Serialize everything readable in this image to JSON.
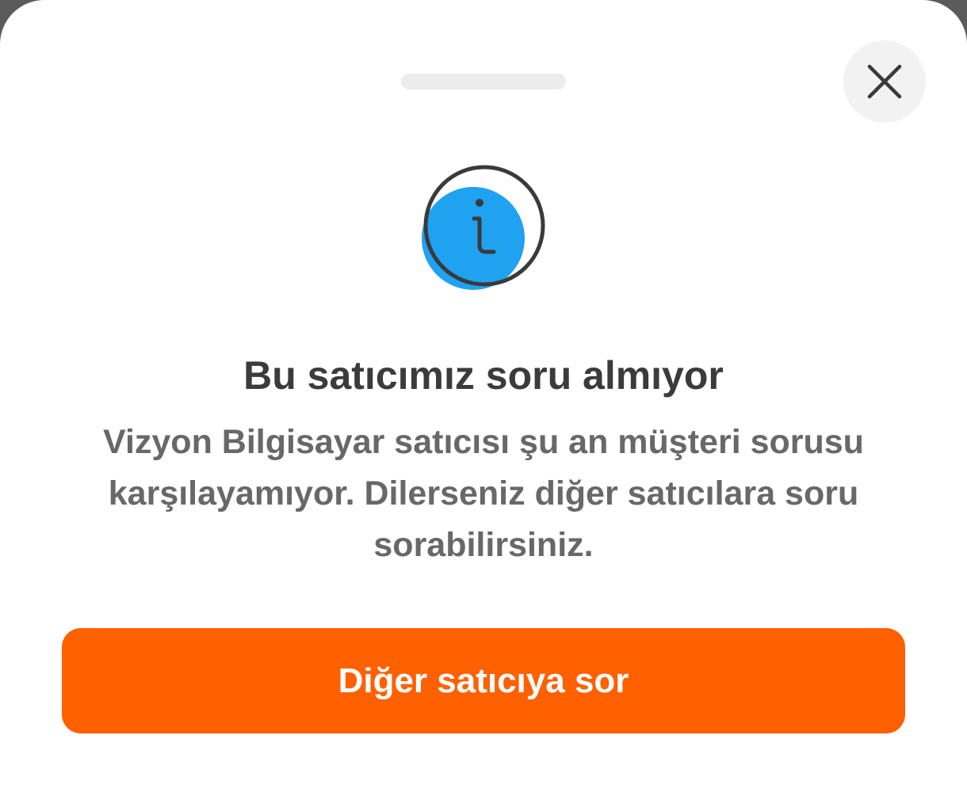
{
  "modal": {
    "close_icon": "close-icon",
    "info_icon": "info-icon",
    "title": "Bu satıcımız soru almıyor",
    "message": "Vizyon Bilgisayar satıcısı şu an müşteri sorusu karşılayamıyor. Dilerseniz diğer satıcılara soru sorabilirsiniz.",
    "primary_button": "Diğer satıcıya sor"
  },
  "colors": {
    "accent": "#ff6000",
    "info_blue": "#1fa2f0",
    "title_text": "#3b3b3b",
    "body_text": "#686868"
  }
}
